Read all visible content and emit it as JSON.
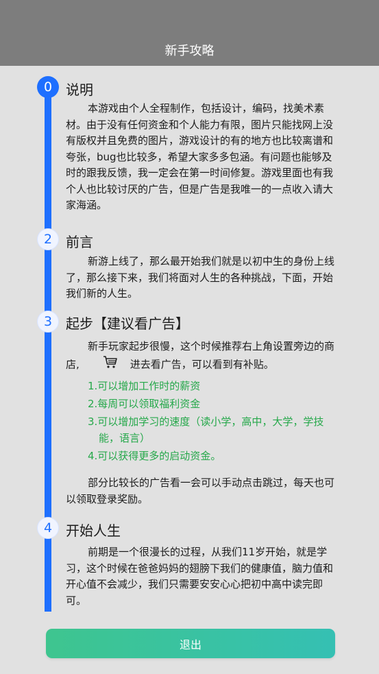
{
  "header": {
    "title": "新手攻略"
  },
  "steps": [
    {
      "number": "0",
      "title": "说明",
      "paragraph": "本游戏由个人全程制作，包括设计，编码，找美术素材。由于没有任何资金和个人能力有限，图片只能找网上没有版权并且免费的图片，游戏设计的有的地方也比较离谱和夸张，bug也比较多，希望大家多多包涵。有问题也能够及时的跟我反馈，我一定会在第一时间修复。游戏里面也有我个人也比较讨厌的广告，但是广告是我唯一的一点收入请大家海涵。"
    },
    {
      "number": "2",
      "title": "前言",
      "paragraph": "新游上线了，那么最开始我们就是以初中生的身份上线了，那么接下来，我们将面对人生的各种挑战，下面，开始我们新的人生。"
    },
    {
      "number": "3",
      "title": "起步【建议看广告】",
      "paragraph_before_icon": "新手玩家起步很慢，这个时候推荐右上角设置旁边的商店,",
      "paragraph_after_icon": "进去看广告，可以看到有补贴。",
      "benefits": [
        "1.可以增加工作时的薪资",
        "2.每周可以领取福利资金",
        "3.可以增加学习的速度（读小学，高中，大学，学技能，语言）",
        "4.可以获得更多的启动资金。"
      ],
      "note": "部分比较长的广告看一会可以手动点击跳过，每天也可以领取登录奖励。"
    },
    {
      "number": "4",
      "title": "开始人生",
      "paragraph": "前期是一个很漫长的过程，从我们11岁开始，就是学习，这个时候在爸爸妈妈的翅膀下我们的健康值，脑力值和开心值不会减少，我们只需要安安心心把初中高中读完即可。"
    }
  ],
  "icons": {
    "shop": "shopping-cart-icon"
  },
  "colors": {
    "accent": "#1e6fff",
    "list_text": "#25a84a",
    "button_start": "#3ec58f",
    "button_end": "#35c0b3",
    "header_bg": "#7d7d7d"
  },
  "footer": {
    "exit_label": "退出"
  }
}
